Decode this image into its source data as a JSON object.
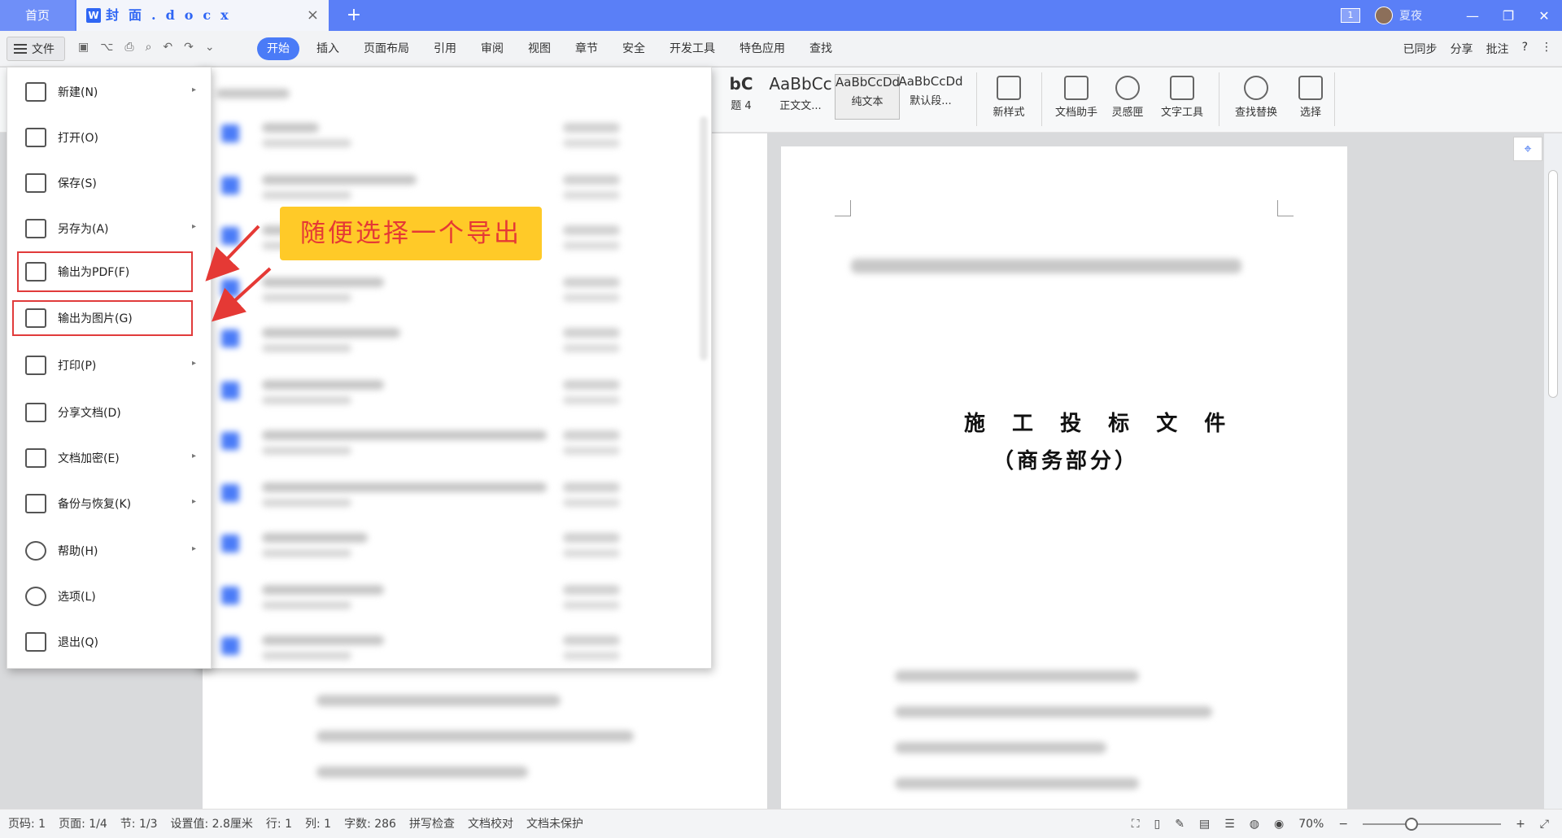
{
  "titlebar": {
    "home_tab": "首页",
    "doc_icon_letter": "W",
    "doc_tab": "封面.docx",
    "close": "×",
    "add": "+",
    "badge": "1",
    "user": "夏夜",
    "minimize": "—",
    "restore": "❐",
    "close_window": "✕"
  },
  "menubar": {
    "file": "文件",
    "tabs": [
      "开始",
      "插入",
      "页面布局",
      "引用",
      "审阅",
      "视图",
      "章节",
      "安全",
      "开发工具",
      "特色应用",
      "查找"
    ],
    "right": [
      "已同步",
      "分享",
      "批注",
      "?",
      "⋮"
    ]
  },
  "ribbon": {
    "styles": [
      {
        "sample": "bC",
        "label": "题 4"
      },
      {
        "sample": "AaBbCc",
        "label": "正文文..."
      },
      {
        "sample": "AaBbCcDd",
        "label": "纯文本"
      },
      {
        "sample": "AaBbCcDd",
        "label": "默认段..."
      }
    ],
    "tools": [
      "新样式",
      "文档助手",
      "灵感匣",
      "文字工具",
      "查找替换",
      "选择"
    ]
  },
  "file_menu": {
    "items": [
      {
        "label": "新建(N)",
        "arrow": true
      },
      {
        "label": "打开(O)",
        "arrow": false
      },
      {
        "label": "保存(S)",
        "arrow": false
      },
      {
        "label": "另存为(A)",
        "arrow": true
      },
      {
        "label": "输出为PDF(F)",
        "arrow": false
      },
      {
        "label": "输出为图片(G)",
        "arrow": false
      },
      {
        "label": "打印(P)",
        "arrow": true
      },
      {
        "label": "分享文档(D)",
        "arrow": false
      },
      {
        "label": "文档加密(E)",
        "arrow": true
      },
      {
        "label": "备份与恢复(K)",
        "arrow": true
      },
      {
        "label": "帮助(H)",
        "arrow": true
      },
      {
        "label": "选项(L)",
        "arrow": false
      },
      {
        "label": "退出(Q)",
        "arrow": false
      }
    ]
  },
  "annotation": {
    "callout_text": "随便选择一个导出"
  },
  "document": {
    "title": "施 工 投 标 文 件",
    "subtitle": "（商务部分）"
  },
  "statusbar": {
    "items": [
      "页码: 1",
      "页面: 1/4",
      "节: 1/3",
      "设置值: 2.8厘米",
      "行: 1",
      "列: 1",
      "字数: 286",
      "拼写检查",
      "文档校对",
      "文档未保护"
    ],
    "zoom": "70%"
  }
}
